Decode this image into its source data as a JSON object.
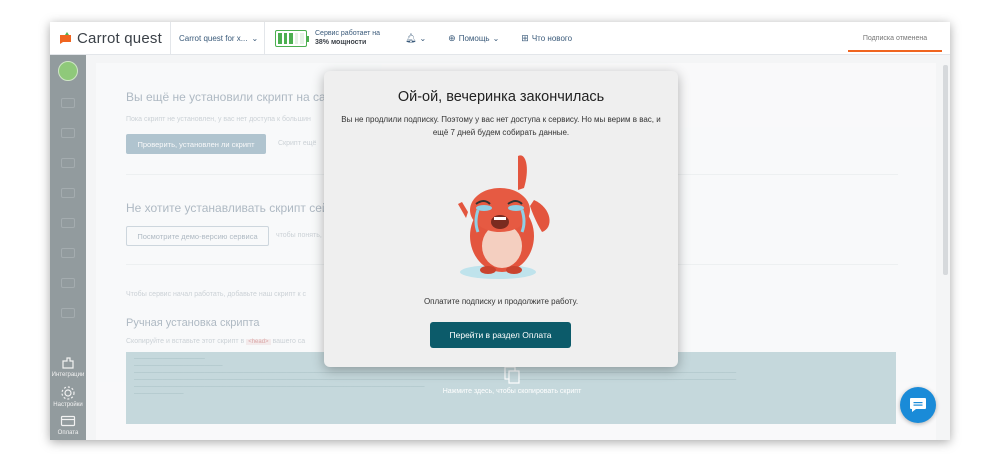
{
  "topbar": {
    "logo_text": "Carrot quest",
    "project_name": "Carrot quest for x...",
    "service_status_line1": "Сервис работает на",
    "service_status_line2": "38% мощности",
    "notifications_icon": "bell-icon",
    "help_label": "Помощь",
    "whats_new_label": "Что нового",
    "subscription_status": "Подписка отменена",
    "accent_color": "#f06520"
  },
  "sidebar": {
    "items": [
      {
        "label": "Интеграции",
        "icon": "integrations-icon"
      },
      {
        "label": "Настройки",
        "icon": "gear-icon"
      },
      {
        "label": "Оплата",
        "icon": "card-icon"
      }
    ]
  },
  "page": {
    "heading_script": "Вы ещё не установили скрипт на сай",
    "script_hint": "Пока скрипт не установлен, у вас нет доступа к большин",
    "check_button": "Проверить, установлен ли скрипт",
    "script_hint_2": "Скрипт ещё",
    "heading_no_install": "Не хотите устанавливать скрипт сейчас?",
    "demo_button": "Посмотрите демо-версию сервиса",
    "demo_hint": "чтобы понять,",
    "intro_text": "Чтобы сервис начал работать, добавьте наш скрипт к с",
    "manual_heading": "Ручная установка скрипта",
    "manual_hint_before": "Скопируйте и вставьте этот скрипт в",
    "manual_hint_tag": "<head>",
    "manual_hint_after": "вашего са",
    "copy_label": "Нажмите здесь, чтобы скопировать скрипт"
  },
  "modal": {
    "title": "Ой-ой, вечеринка закончилась",
    "text": "Вы не продлили подписку. Поэтому у вас нет доступа к сервису. Но мы верим в вас, и ещё 7 дней будем собирать данные.",
    "note": "Оплатите подписку и продолжите работу.",
    "button": "Перейти в раздел Оплата",
    "button_color": "#0c5b6a",
    "illustration": "crying-rabbit-icon"
  },
  "chat": {
    "icon": "chat-icon",
    "color": "#1a8bd8"
  }
}
